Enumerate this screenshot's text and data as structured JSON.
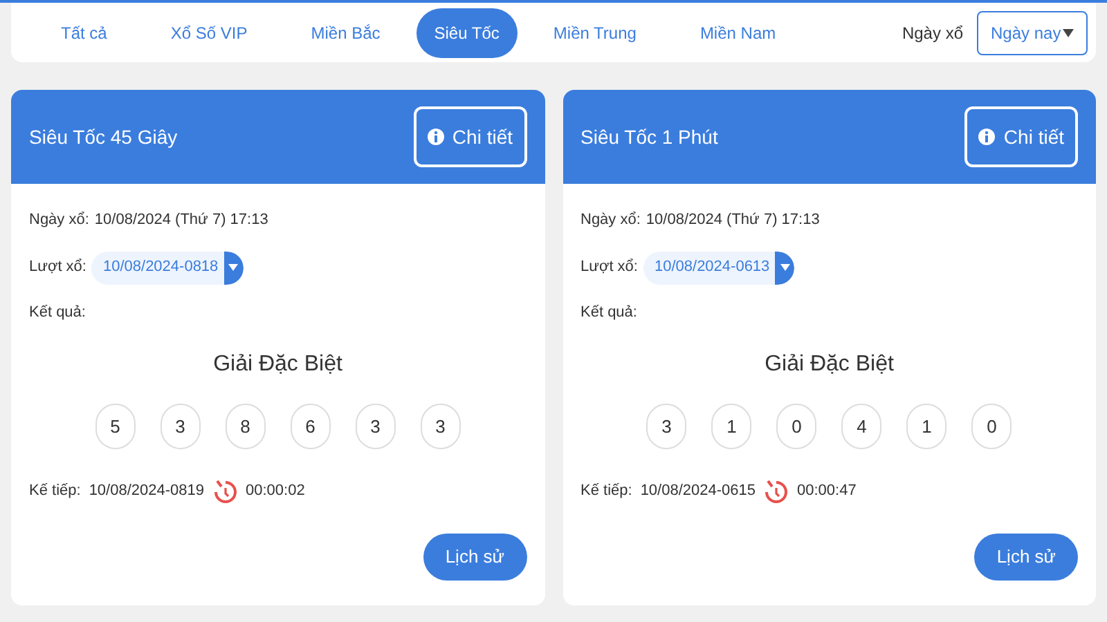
{
  "tabs": [
    {
      "label": "Tất cả",
      "selected": false
    },
    {
      "label": "Xổ Số VIP",
      "selected": false
    },
    {
      "label": "Miền Bắc",
      "selected": false
    },
    {
      "label": "Siêu Tốc",
      "selected": true
    },
    {
      "label": "Miền Trung",
      "selected": false
    },
    {
      "label": "Miền Nam",
      "selected": false
    }
  ],
  "date_filter": {
    "label": "Ngày xổ",
    "value": "Ngày nay"
  },
  "cards": [
    {
      "title": "Siêu Tốc 45 Giây",
      "detail_button": "Chi tiết",
      "draw_date_label": "Ngày xổ:",
      "draw_date": "10/08/2024 (Thứ 7) 17:13",
      "round_label": "Lượt xổ:",
      "round": "10/08/2024-0818",
      "result_label": "Kết quả:",
      "prize_title": "Giải Đặc Biệt",
      "digits": [
        "5",
        "3",
        "8",
        "6",
        "3",
        "3"
      ],
      "next_label": "Kế tiếp:",
      "next_round": "10/08/2024-0819",
      "countdown": "00:00:02",
      "history_button": "Lịch sử"
    },
    {
      "title": "Siêu Tốc 1 Phút",
      "detail_button": "Chi tiết",
      "draw_date_label": "Ngày xổ:",
      "draw_date": "10/08/2024 (Thứ 7) 17:13",
      "round_label": "Lượt xổ:",
      "round": "10/08/2024-0613",
      "result_label": "Kết quả:",
      "prize_title": "Giải Đặc Biệt",
      "digits": [
        "3",
        "1",
        "0",
        "4",
        "1",
        "0"
      ],
      "next_label": "Kế tiếp:",
      "next_round": "10/08/2024-0615",
      "countdown": "00:00:47",
      "history_button": "Lịch sử"
    }
  ]
}
